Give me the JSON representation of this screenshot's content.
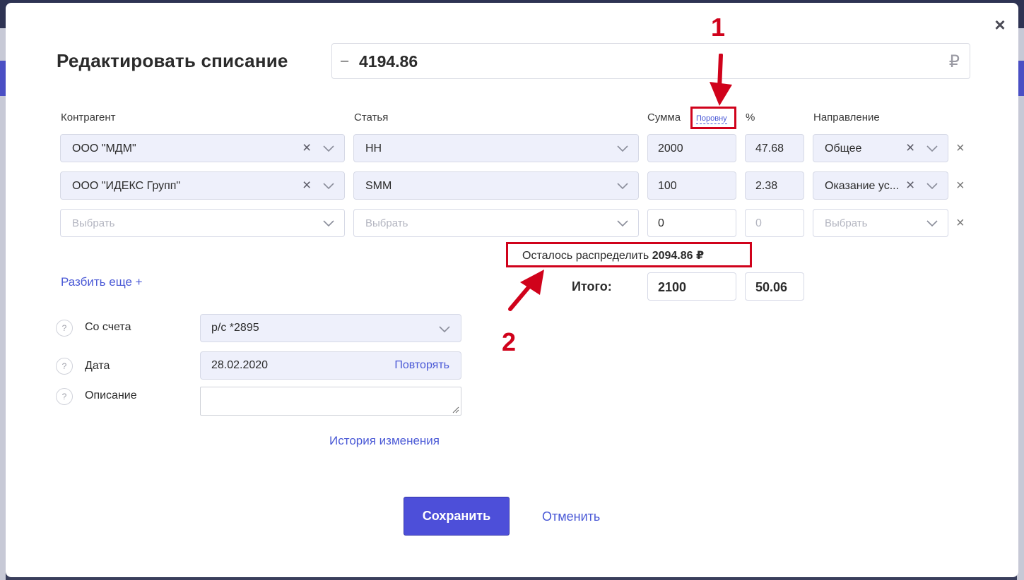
{
  "dialog": {
    "title": "Редактировать списание",
    "amount_sign": "–",
    "amount": "4194.86",
    "currency": "₽",
    "close_glyph": "×"
  },
  "columns": {
    "counterparty": "Контрагент",
    "article": "Статья",
    "sum": "Сумма",
    "equal_link": "Поровну",
    "percent": "%",
    "direction": "Направление"
  },
  "rows": [
    {
      "counterparty": "ООО \"МДМ\"",
      "article": "НН",
      "sum": "2000",
      "percent": "47.68",
      "direction": "Общее"
    },
    {
      "counterparty": "ООО \"ИДЕКС Групп\"",
      "article": "SMM",
      "sum": "100",
      "percent": "2.38",
      "direction": "Оказание ус..."
    },
    {
      "counterparty_placeholder": "Выбрать",
      "article_placeholder": "Выбрать",
      "sum": "0",
      "percent_placeholder": "0",
      "direction_placeholder": "Выбрать"
    }
  ],
  "remaining": {
    "label": "Осталось распределить",
    "value": "2094.86 ₽"
  },
  "split_more": "Разбить еще +",
  "totals": {
    "label": "Итого:",
    "sum": "2100",
    "percent": "50.06"
  },
  "account": {
    "label": "Со счета",
    "value": "р/с *2895"
  },
  "date": {
    "label": "Дата",
    "value": "28.02.2020",
    "repeat": "Повторять"
  },
  "description": {
    "label": "Описание",
    "value": ""
  },
  "history_link": "История изменения",
  "help_glyph": "?",
  "actions": {
    "save": "Сохранить",
    "cancel": "Отменить"
  },
  "annotations": {
    "one": "1",
    "two": "2"
  },
  "icons": {
    "clear": "close-x-icon",
    "dropdown": "chevron-down-icon",
    "remove_row": "remove-row-icon",
    "help": "question-icon"
  },
  "colors": {
    "accent": "#4d4fd9",
    "link": "#4a59d6",
    "annotation": "#d0021b",
    "field_bg": "#eef0fb"
  }
}
